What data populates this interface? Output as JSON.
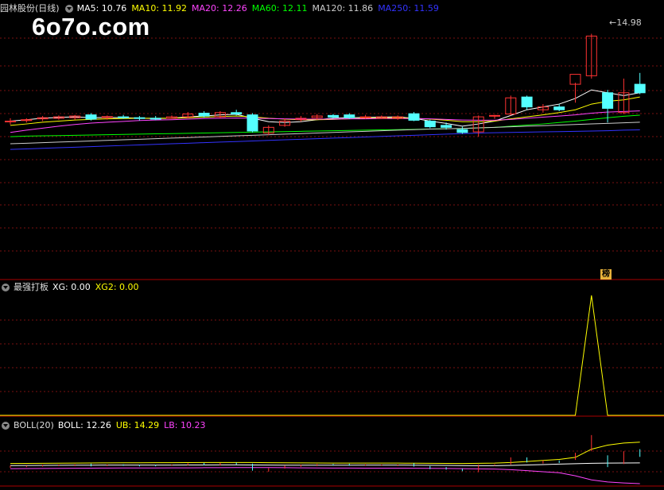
{
  "price_panel": {
    "title": "园林股份(日线)",
    "indicators": [
      {
        "text": "MA5: 10.76",
        "color": "#ffffff"
      },
      {
        "text": "MA10: 11.92",
        "color": "#ffff00"
      },
      {
        "text": "MA20: 12.26",
        "color": "#ff44ff"
      },
      {
        "text": "MA60: 12.11",
        "color": "#00ff00"
      },
      {
        "text": "MA120: 11.86",
        "color": "#cccccc"
      },
      {
        "text": "MA250: 11.59",
        "color": "#3333ff"
      }
    ],
    "high_label": "14.98",
    "badge": "榜",
    "watermark": "6o7o.com"
  },
  "xg_panel": {
    "title": "最强打板",
    "values": [
      {
        "text": "XG: 0.00",
        "color": "#ffffff"
      },
      {
        "text": "XG2: 0.00",
        "color": "#ffff00"
      }
    ]
  },
  "boll_panel": {
    "title": "BOLL(20)",
    "values": [
      {
        "text": "BOLL: 12.26",
        "color": "#ffffff"
      },
      {
        "text": "UB: 14.29",
        "color": "#ffff00"
      },
      {
        "text": "LB: 10.23",
        "color": "#ff44ff"
      }
    ]
  },
  "colors": {
    "up": "#ff3232",
    "down": "#54ffff",
    "grid": "#7a1010",
    "divider": "#aa0000"
  },
  "chart_data": {
    "type": "candlestick",
    "price_axis_range": [
      9.0,
      15.5
    ],
    "candles": [
      {
        "o": 11.88,
        "h": 12.0,
        "l": 11.78,
        "c": 11.9
      },
      {
        "o": 11.92,
        "h": 12.0,
        "l": 11.85,
        "c": 11.95
      },
      {
        "o": 11.98,
        "h": 12.08,
        "l": 11.9,
        "c": 12.02
      },
      {
        "o": 12.0,
        "h": 12.1,
        "l": 11.95,
        "c": 12.05
      },
      {
        "o": 12.02,
        "h": 12.12,
        "l": 11.95,
        "c": 12.08
      },
      {
        "o": 12.12,
        "h": 12.18,
        "l": 11.92,
        "c": 11.97
      },
      {
        "o": 12.02,
        "h": 12.1,
        "l": 11.95,
        "c": 12.06
      },
      {
        "o": 12.05,
        "h": 12.12,
        "l": 11.98,
        "c": 12.02
      },
      {
        "o": 12.02,
        "h": 12.08,
        "l": 11.92,
        "c": 12.0
      },
      {
        "o": 12.0,
        "h": 12.08,
        "l": 11.93,
        "c": 11.97
      },
      {
        "o": 12.0,
        "h": 12.1,
        "l": 11.98,
        "c": 12.05
      },
      {
        "o": 12.05,
        "h": 12.22,
        "l": 12.0,
        "c": 12.15
      },
      {
        "o": 12.18,
        "h": 12.25,
        "l": 12.02,
        "c": 12.08
      },
      {
        "o": 12.05,
        "h": 12.25,
        "l": 12.0,
        "c": 12.2
      },
      {
        "o": 12.2,
        "h": 12.3,
        "l": 12.1,
        "c": 12.15
      },
      {
        "o": 12.12,
        "h": 12.18,
        "l": 11.5,
        "c": 11.55
      },
      {
        "o": 11.48,
        "h": 11.75,
        "l": 11.4,
        "c": 11.68
      },
      {
        "o": 11.75,
        "h": 12.0,
        "l": 11.7,
        "c": 11.9
      },
      {
        "o": 11.95,
        "h": 12.08,
        "l": 11.88,
        "c": 12.0
      },
      {
        "o": 12.02,
        "h": 12.15,
        "l": 11.95,
        "c": 12.08
      },
      {
        "o": 12.1,
        "h": 12.15,
        "l": 12.0,
        "c": 12.04
      },
      {
        "o": 12.12,
        "h": 12.18,
        "l": 11.98,
        "c": 12.02
      },
      {
        "o": 12.05,
        "h": 12.12,
        "l": 11.98,
        "c": 12.05
      },
      {
        "o": 12.0,
        "h": 12.1,
        "l": 11.98,
        "c": 12.05
      },
      {
        "o": 12.0,
        "h": 12.1,
        "l": 11.95,
        "c": 12.05
      },
      {
        "o": 12.16,
        "h": 12.22,
        "l": 11.9,
        "c": 11.93
      },
      {
        "o": 11.9,
        "h": 11.95,
        "l": 11.65,
        "c": 11.7
      },
      {
        "o": 11.75,
        "h": 11.85,
        "l": 11.6,
        "c": 11.68
      },
      {
        "o": 11.6,
        "h": 11.7,
        "l": 11.45,
        "c": 11.5
      },
      {
        "o": 11.52,
        "h": 12.1,
        "l": 11.35,
        "c": 12.05
      },
      {
        "o": 12.08,
        "h": 12.12,
        "l": 11.98,
        "c": 12.1
      },
      {
        "o": 12.15,
        "h": 12.8,
        "l": 12.1,
        "c": 12.72
      },
      {
        "o": 12.75,
        "h": 12.8,
        "l": 12.3,
        "c": 12.4
      },
      {
        "o": 12.3,
        "h": 12.5,
        "l": 12.2,
        "c": 12.4
      },
      {
        "o": 12.4,
        "h": 12.5,
        "l": 12.25,
        "c": 12.3
      },
      {
        "o": 13.2,
        "h": 13.25,
        "l": 12.55,
        "c": 13.55
      },
      {
        "o": 13.5,
        "h": 14.98,
        "l": 13.4,
        "c": 14.9
      },
      {
        "o": 12.9,
        "h": 13.0,
        "l": 11.85,
        "c": 12.35
      },
      {
        "o": 12.2,
        "h": 13.4,
        "l": 12.15,
        "c": 12.9
      },
      {
        "o": 13.2,
        "h": 13.6,
        "l": 12.85,
        "c": 12.9
      }
    ],
    "ma_series": [
      {
        "name": "MA5",
        "color": "#ffffff",
        "values": [
          11.9,
          11.95,
          12.0,
          12.03,
          12.05,
          12.02,
          12.03,
          12.02,
          12.0,
          11.99,
          12.0,
          12.05,
          12.08,
          12.12,
          12.14,
          12.0,
          11.88,
          11.85,
          11.88,
          11.95,
          12.0,
          12.02,
          12.03,
          12.04,
          12.05,
          12.0,
          11.9,
          11.82,
          11.72,
          11.8,
          11.9,
          12.1,
          12.3,
          12.4,
          12.5,
          12.7,
          13.0,
          12.9,
          12.8,
          12.9
        ]
      },
      {
        "name": "MA10",
        "color": "#ffff00",
        "values": [
          11.75,
          11.8,
          11.86,
          11.9,
          11.94,
          11.96,
          11.98,
          11.99,
          12.0,
          12.0,
          12.0,
          12.02,
          12.04,
          12.06,
          12.08,
          12.05,
          12.0,
          11.97,
          11.95,
          11.95,
          11.96,
          11.98,
          12.0,
          12.01,
          12.02,
          12.0,
          11.97,
          11.93,
          11.88,
          11.88,
          11.9,
          11.98,
          12.05,
          12.12,
          12.2,
          12.3,
          12.5,
          12.6,
          12.65,
          12.75
        ]
      },
      {
        "name": "MA20",
        "color": "#ff44ff",
        "values": [
          11.5,
          11.58,
          11.65,
          11.72,
          11.78,
          11.83,
          11.86,
          11.89,
          11.92,
          11.94,
          11.95,
          11.97,
          11.99,
          12.0,
          12.01,
          12.0,
          11.99,
          11.98,
          11.97,
          11.97,
          11.97,
          11.98,
          11.98,
          11.99,
          11.99,
          11.99,
          11.98,
          11.96,
          11.94,
          11.93,
          11.93,
          11.96,
          12.0,
          12.04,
          12.08,
          12.12,
          12.18,
          12.22,
          12.24,
          12.26
        ]
      },
      {
        "name": "MA60",
        "color": "#00ff00",
        "values": [
          11.35,
          11.37,
          11.38,
          11.39,
          11.4,
          11.41,
          11.42,
          11.43,
          11.44,
          11.45,
          11.46,
          11.47,
          11.48,
          11.49,
          11.5,
          11.51,
          11.52,
          11.53,
          11.54,
          11.55,
          11.56,
          11.57,
          11.58,
          11.59,
          11.6,
          11.61,
          11.62,
          11.63,
          11.64,
          11.66,
          11.68,
          11.72,
          11.76,
          11.8,
          11.85,
          11.9,
          11.96,
          12.02,
          12.07,
          12.11
        ]
      },
      {
        "name": "MA120",
        "color": "#cccccc",
        "values": [
          11.1,
          11.12,
          11.14,
          11.16,
          11.18,
          11.2,
          11.22,
          11.24,
          11.26,
          11.28,
          11.3,
          11.32,
          11.34,
          11.36,
          11.38,
          11.4,
          11.42,
          11.44,
          11.46,
          11.48,
          11.5,
          11.52,
          11.54,
          11.56,
          11.58,
          11.6,
          11.62,
          11.63,
          11.64,
          11.66,
          11.68,
          11.7,
          11.72,
          11.74,
          11.76,
          11.78,
          11.8,
          11.82,
          11.84,
          11.86
        ]
      },
      {
        "name": "MA250",
        "color": "#3333ff",
        "values": [
          10.9,
          10.92,
          10.94,
          10.96,
          10.98,
          11.0,
          11.02,
          11.04,
          11.06,
          11.08,
          11.1,
          11.12,
          11.14,
          11.16,
          11.18,
          11.2,
          11.22,
          11.24,
          11.26,
          11.28,
          11.3,
          11.32,
          11.34,
          11.36,
          11.38,
          11.4,
          11.42,
          11.44,
          11.46,
          11.48,
          11.49,
          11.5,
          11.51,
          11.52,
          11.53,
          11.54,
          11.55,
          11.56,
          11.58,
          11.59
        ]
      }
    ],
    "xg_series": [
      0,
      0,
      0,
      0,
      0,
      0,
      0,
      0,
      0,
      0,
      0,
      0,
      0,
      0,
      0,
      0,
      0,
      0,
      0,
      0,
      0,
      0,
      0,
      0,
      0,
      0,
      0,
      0,
      0,
      0,
      0,
      0,
      0,
      0,
      0,
      0,
      1,
      0,
      0,
      0
    ],
    "boll": {
      "mid": [
        12.0,
        12.01,
        12.02,
        12.03,
        12.04,
        12.04,
        12.05,
        12.05,
        12.05,
        12.05,
        12.05,
        12.06,
        12.06,
        12.07,
        12.07,
        12.06,
        12.05,
        12.04,
        12.04,
        12.04,
        12.04,
        12.04,
        12.05,
        12.05,
        12.05,
        12.04,
        12.03,
        12.02,
        12.0,
        11.99,
        11.99,
        12.02,
        12.06,
        12.1,
        12.14,
        12.18,
        12.22,
        12.24,
        12.25,
        12.26
      ],
      "ub": [
        12.2,
        12.21,
        12.22,
        12.23,
        12.24,
        12.25,
        12.26,
        12.27,
        12.27,
        12.28,
        12.28,
        12.29,
        12.3,
        12.3,
        12.3,
        12.3,
        12.28,
        12.27,
        12.26,
        12.25,
        12.24,
        12.24,
        12.24,
        12.24,
        12.24,
        12.23,
        12.22,
        12.21,
        12.2,
        12.22,
        12.24,
        12.3,
        12.4,
        12.5,
        12.6,
        12.8,
        13.6,
        14.0,
        14.2,
        14.29
      ],
      "lb": [
        11.7,
        11.71,
        11.72,
        11.73,
        11.74,
        11.75,
        11.76,
        11.77,
        11.77,
        11.77,
        11.78,
        11.78,
        11.79,
        11.79,
        11.8,
        11.8,
        11.8,
        11.79,
        11.78,
        11.77,
        11.76,
        11.76,
        11.75,
        11.75,
        11.75,
        11.74,
        11.73,
        11.72,
        11.7,
        11.68,
        11.66,
        11.6,
        11.5,
        11.4,
        11.3,
        11.0,
        10.6,
        10.4,
        10.3,
        10.23
      ],
      "range": [
        10.0,
        15.2
      ]
    }
  }
}
